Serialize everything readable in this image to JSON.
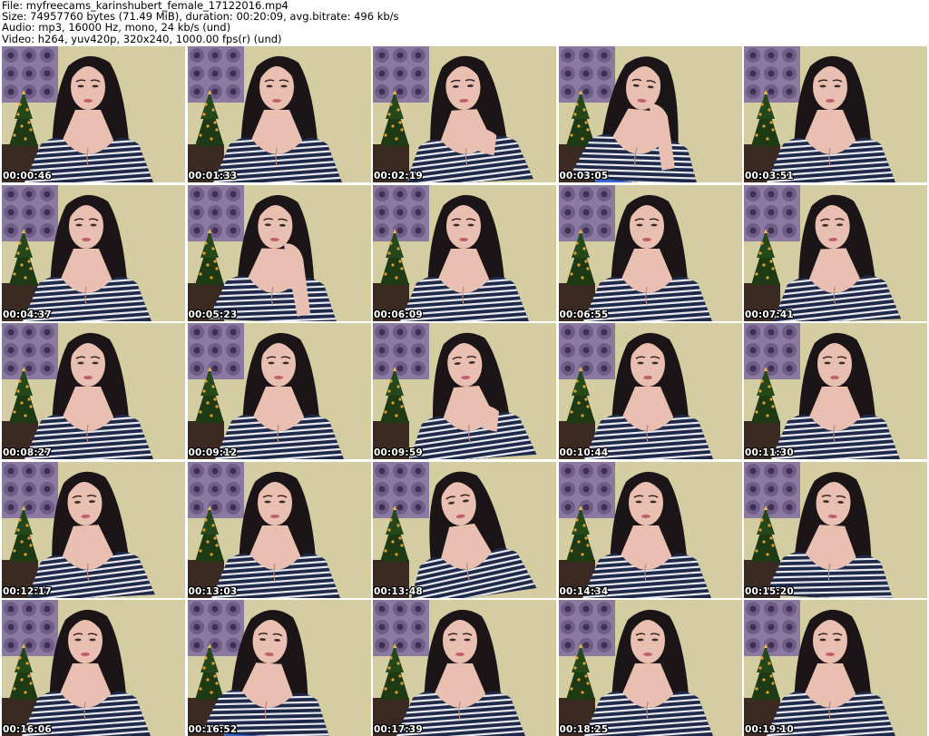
{
  "header": {
    "file_line": "File: myfreecams_karinshubert_female_17122016.mp4",
    "size_line": "Size: 74957760 bytes (71.49 MiB), duration: 00:20:09, avg.bitrate: 496 kb/s",
    "audio_line": "Audio: mp3, 16000 Hz, mono, 24 kb/s (und)",
    "video_line": "Video: h264, yuv420p, 320x240, 1000.00 fps(r) (und)"
  },
  "thumbnails": [
    {
      "timestamp": "00:00:46"
    },
    {
      "timestamp": "00:01:33"
    },
    {
      "timestamp": "00:02:19"
    },
    {
      "timestamp": "00:03:05"
    },
    {
      "timestamp": "00:03:51"
    },
    {
      "timestamp": "00:04:37"
    },
    {
      "timestamp": "00:05:23"
    },
    {
      "timestamp": "00:06:09"
    },
    {
      "timestamp": "00:06:55"
    },
    {
      "timestamp": "00:07:41"
    },
    {
      "timestamp": "00:08:27"
    },
    {
      "timestamp": "00:09:12"
    },
    {
      "timestamp": "00:09:59"
    },
    {
      "timestamp": "00:10:44"
    },
    {
      "timestamp": "00:11:30"
    },
    {
      "timestamp": "00:12:17"
    },
    {
      "timestamp": "00:13:03"
    },
    {
      "timestamp": "00:13:48"
    },
    {
      "timestamp": "00:14:34"
    },
    {
      "timestamp": "00:15:20"
    },
    {
      "timestamp": "00:16:06"
    },
    {
      "timestamp": "00:16:52"
    },
    {
      "timestamp": "00:17:39"
    },
    {
      "timestamp": "00:18:25"
    },
    {
      "timestamp": "00:19:10"
    }
  ],
  "colors": {
    "wall": "#d4cda2",
    "wallpaper_purple": "#6b5a86",
    "hair": "#1c1518",
    "skin": "#e8bfb0",
    "shirt_navy": "#1f2a4a",
    "shirt_stripe": "#e8e8ee",
    "tree_green": "#1d3a14",
    "tree_lights": "#e0a030",
    "chair_blue": "#2c5fd0"
  }
}
